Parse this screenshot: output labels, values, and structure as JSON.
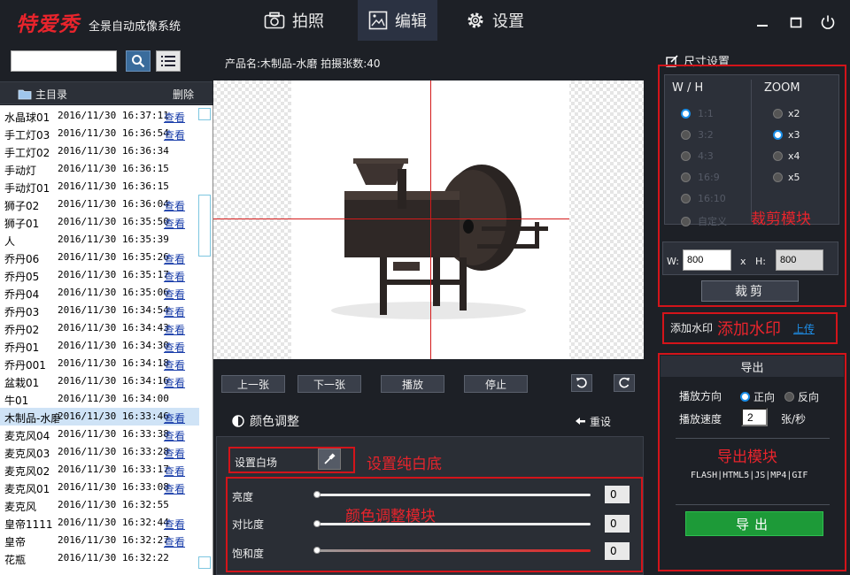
{
  "app": {
    "logo": "特爱秀",
    "subtitle": "全景自动成像系统"
  },
  "nav": {
    "tabs": [
      {
        "label": "拍照"
      },
      {
        "label": "编辑"
      },
      {
        "label": "设置"
      }
    ]
  },
  "left": {
    "search_value": "",
    "tree_label": "主目录",
    "delete_label": "删除",
    "items": [
      {
        "name": "水晶球01",
        "date": "2016/11/30 16:37:11",
        "view": "查看"
      },
      {
        "name": "手工灯03",
        "date": "2016/11/30 16:36:54",
        "view": "查看"
      },
      {
        "name": "手工灯02",
        "date": "2016/11/30 16:36:34",
        "view": ""
      },
      {
        "name": "手动灯",
        "date": "2016/11/30 16:36:15",
        "view": ""
      },
      {
        "name": "手动灯01",
        "date": "2016/11/30 16:36:15",
        "view": ""
      },
      {
        "name": "狮子02",
        "date": "2016/11/30 16:36:04",
        "view": "查看"
      },
      {
        "name": "狮子01",
        "date": "2016/11/30 16:35:50",
        "view": "查看"
      },
      {
        "name": "人",
        "date": "2016/11/30 16:35:39",
        "view": ""
      },
      {
        "name": "乔丹06",
        "date": "2016/11/30 16:35:26",
        "view": "查看"
      },
      {
        "name": "乔丹05",
        "date": "2016/11/30 16:35:17",
        "view": "查看"
      },
      {
        "name": "乔丹04",
        "date": "2016/11/30 16:35:06",
        "view": "查看"
      },
      {
        "name": "乔丹03",
        "date": "2016/11/30 16:34:54",
        "view": "查看"
      },
      {
        "name": "乔丹02",
        "date": "2016/11/30 16:34:43",
        "view": "查看"
      },
      {
        "name": "乔丹01",
        "date": "2016/11/30 16:34:30",
        "view": "查看"
      },
      {
        "name": "乔丹001",
        "date": "2016/11/30 16:34:18",
        "view": "查看"
      },
      {
        "name": "盆栽01",
        "date": "2016/11/30 16:34:16",
        "view": "查看"
      },
      {
        "name": "牛01",
        "date": "2016/11/30 16:34:00",
        "view": ""
      },
      {
        "name": "木制品-水磨",
        "date": "2016/11/30 16:33:46",
        "view": "查看",
        "selected": true
      },
      {
        "name": "麦克风04",
        "date": "2016/11/30 16:33:38",
        "view": "查看"
      },
      {
        "name": "麦克风03",
        "date": "2016/11/30 16:33:28",
        "view": "查看"
      },
      {
        "name": "麦克风02",
        "date": "2016/11/30 16:33:17",
        "view": "查看"
      },
      {
        "name": "麦克风01",
        "date": "2016/11/30 16:33:08",
        "view": "查看"
      },
      {
        "name": "麦克风",
        "date": "2016/11/30 16:32:55",
        "view": ""
      },
      {
        "name": "皇帝1111",
        "date": "2016/11/30 16:32:44",
        "view": "查看"
      },
      {
        "name": "皇帝",
        "date": "2016/11/30 16:32:27",
        "view": "查看"
      },
      {
        "name": "花瓶",
        "date": "2016/11/30 16:32:22",
        "view": ""
      }
    ]
  },
  "center": {
    "product_info": "产品名:木制品-水磨  拍摄张数:40",
    "buttons": {
      "prev": "上一张",
      "next": "下一张",
      "play": "播放",
      "stop": "停止"
    },
    "color_title": "颜色调整",
    "reset": "重设",
    "white_label": "设置白场",
    "ann_white": "设置纯白底",
    "ann_color": "颜色调整模块",
    "sliders": [
      {
        "label": "亮度",
        "value": "0"
      },
      {
        "label": "对比度",
        "value": "0"
      },
      {
        "label": "饱和度",
        "value": "0"
      }
    ]
  },
  "right": {
    "size_title": "尺寸设置",
    "wh_header": "W / H",
    "zoom_header": "ZOOM",
    "ratios": [
      {
        "label": "1:1",
        "checked": true
      },
      {
        "label": "3:2",
        "checked": false
      },
      {
        "label": "4:3",
        "checked": false
      },
      {
        "label": "16:9",
        "checked": false
      },
      {
        "label": "16:10",
        "checked": false
      },
      {
        "label": "自定义",
        "checked": false
      }
    ],
    "zooms": [
      {
        "label": "x2",
        "checked": false
      },
      {
        "label": "x3",
        "checked": true
      },
      {
        "label": "x4",
        "checked": false
      },
      {
        "label": "x5",
        "checked": false
      }
    ],
    "ann_crop": "裁剪模块",
    "w_label": "W:",
    "w_value": "800",
    "x_label": "x",
    "h_label": "H:",
    "h_value": "800",
    "crop_button": "裁剪",
    "watermark_label": "添加水印",
    "ann_watermark": "添加水印",
    "upload": "上传",
    "export_title": "导出",
    "direction_label": "播放方向",
    "forward": "正向",
    "reverse": "反向",
    "speed_label": "播放速度",
    "speed_value": "2",
    "speed_unit": "张/秒",
    "ann_export": "导出模块",
    "formats": "FLASH|HTML5|JS|MP4|GIF",
    "export_button": "导出"
  }
}
